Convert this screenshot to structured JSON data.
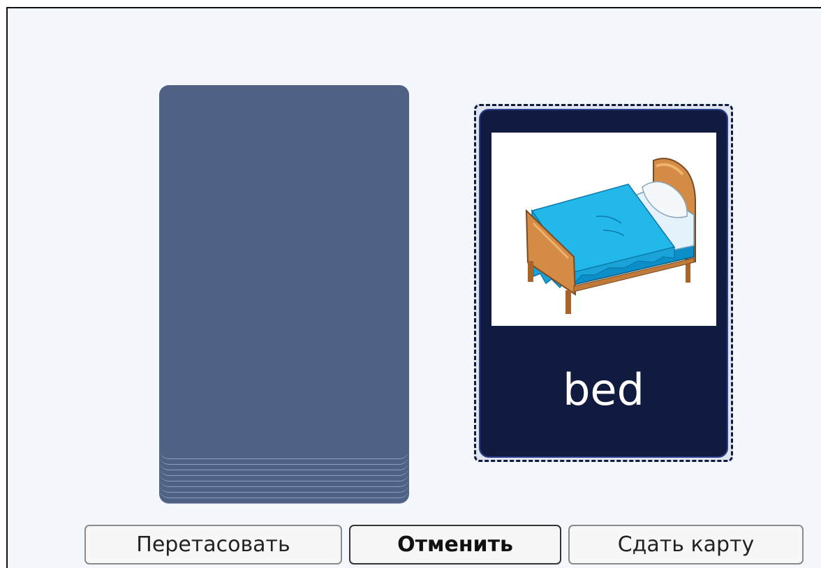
{
  "deck": {
    "card_count": 10
  },
  "card": {
    "word": "bed",
    "image_icon": "bed-icon"
  },
  "buttons": {
    "shuffle": "Перетасовать",
    "undo": "Отменить",
    "deal": "Сдать карту"
  }
}
